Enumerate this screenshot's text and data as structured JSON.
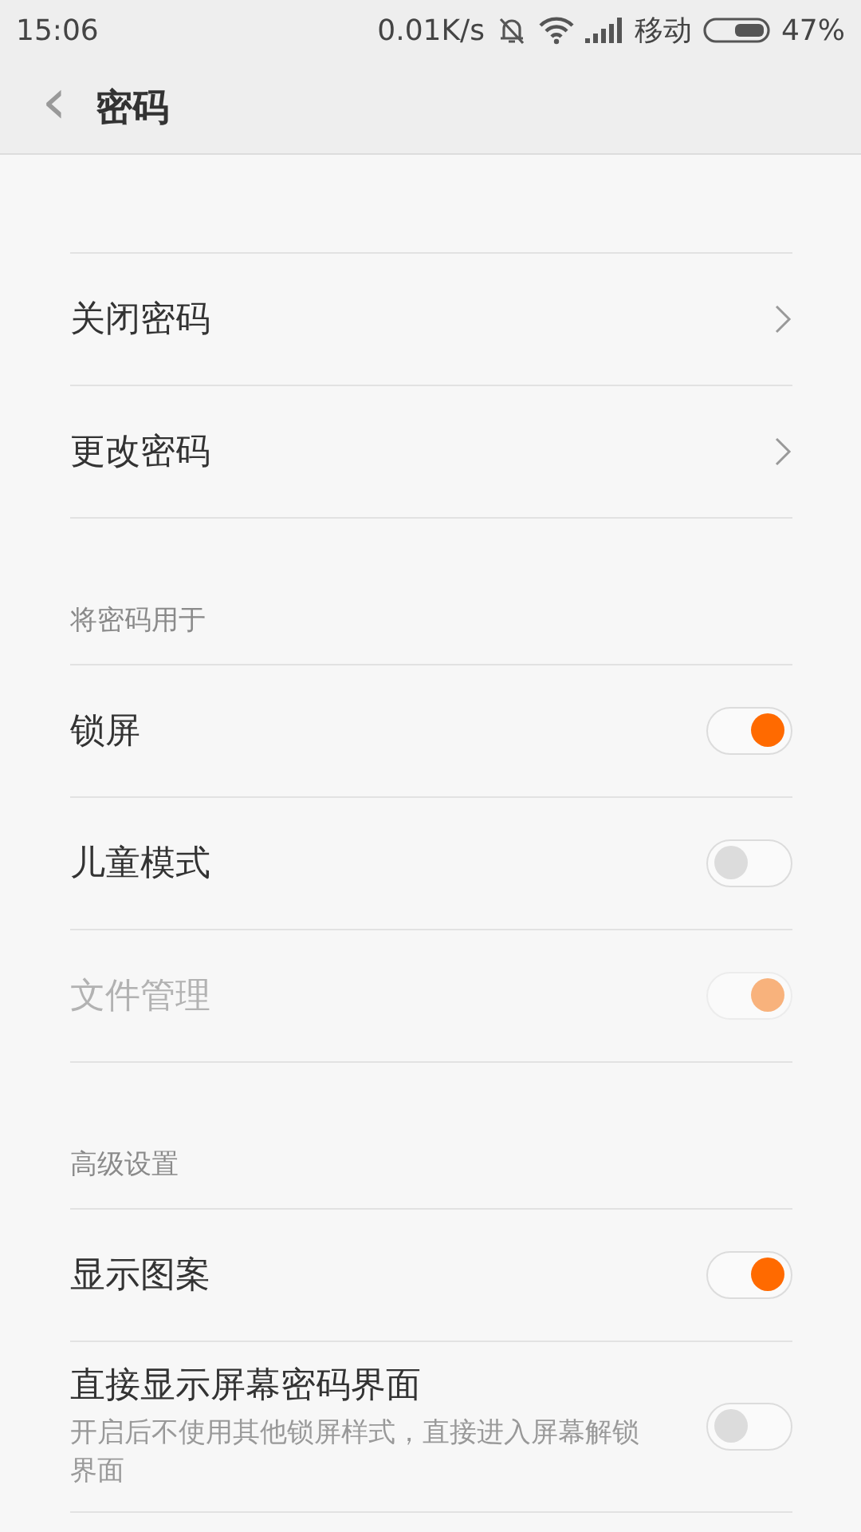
{
  "status_bar": {
    "time": "15:06",
    "speed": "0.01K/s",
    "carrier": "移动",
    "battery": "47%"
  },
  "header": {
    "back": "‹",
    "title": "密码"
  },
  "sections": [
    {
      "items": [
        {
          "kind": "nav",
          "label": "关闭密码"
        },
        {
          "kind": "nav",
          "label": "更改密码"
        }
      ]
    },
    {
      "title": "将密码用于",
      "items": [
        {
          "kind": "toggle",
          "label": "锁屏",
          "on": true,
          "disabled": false
        },
        {
          "kind": "toggle",
          "label": "儿童模式",
          "on": false,
          "disabled": false
        },
        {
          "kind": "toggle",
          "label": "文件管理",
          "on": true,
          "disabled": true
        }
      ]
    },
    {
      "title": "高级设置",
      "items": [
        {
          "kind": "toggle",
          "label": "显示图案",
          "on": true,
          "disabled": false
        },
        {
          "kind": "toggle",
          "label": "直接显示屏幕密码界面",
          "description": "开启后不使用其他锁屏样式，直接进入屏幕解锁界面",
          "on": false,
          "disabled": false
        }
      ]
    }
  ]
}
